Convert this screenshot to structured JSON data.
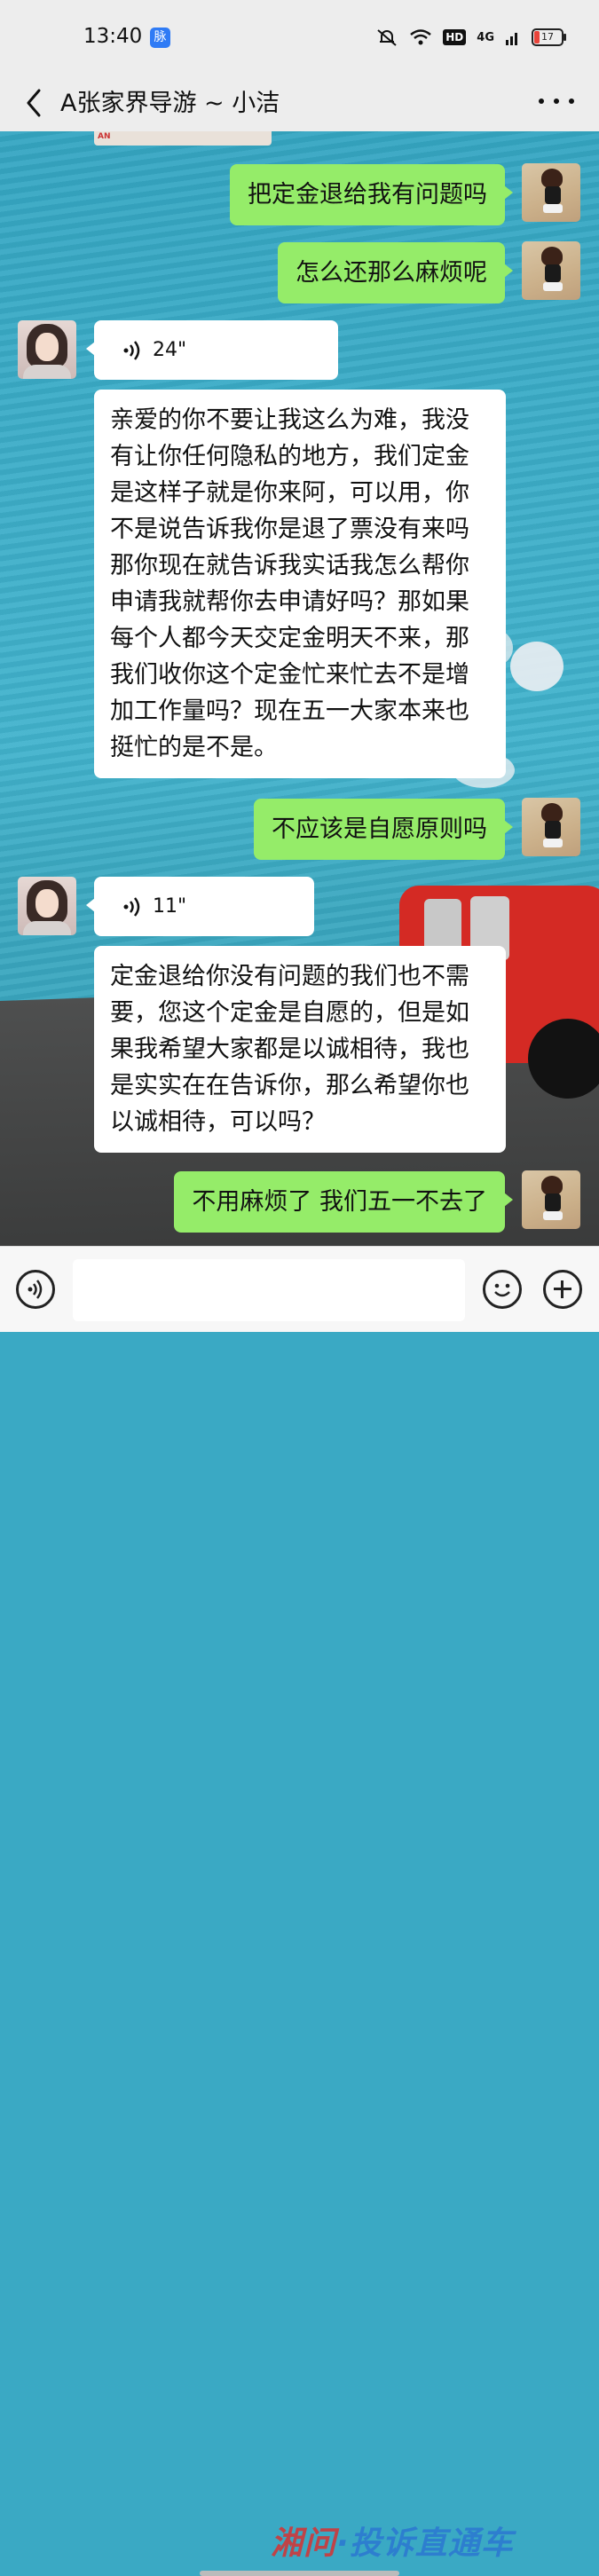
{
  "status_bar": {
    "time": "13:40",
    "app_badge": "脉",
    "hd": "HD",
    "network": "4G",
    "battery": "17"
  },
  "header": {
    "title": "A张家界导游 ~ 小洁"
  },
  "messages": [
    {
      "from": "me",
      "text": "把定金退给我有问题吗"
    },
    {
      "from": "me",
      "text": "怎么还那么麻烦呢"
    },
    {
      "from": "them",
      "type": "voice",
      "duration": "24\""
    },
    {
      "from": "them",
      "lines": [
        "亲爱的你不要让我这么为难，我没",
        "有让你任何隐私的地方，我们定金",
        "是这样子就是你来阿，可以用，你",
        "不是说告诉我你是退了票没有来吗",
        "那你现在就告诉我实话我怎么帮你",
        "申请我就帮你去申请好吗？那如果",
        "每个人都今天交定金明天不来，那",
        "我们收你这个定金忙来忙去不是增",
        "加工作量吗？现在五一大家本来也",
        "挺忙的是不是。"
      ]
    },
    {
      "from": "me",
      "text": "不应该是自愿原则吗"
    },
    {
      "from": "them",
      "type": "voice",
      "duration": "11\""
    },
    {
      "from": "them",
      "lines": [
        "定金退给你没有问题的我们也不需",
        "要，您这个定金是自愿的，但是如",
        "果我希望大家都是以诚相待，我也",
        "是实实在在告诉你，那么希望你也",
        "以诚相待，可以吗？"
      ]
    },
    {
      "from": "me",
      "text": "不用麻烦了 我们五一不去了"
    }
  ],
  "input_bar": {
    "placeholder": ""
  },
  "watermark": {
    "part1": "湘问",
    "part2": "·投诉直通车"
  },
  "icons": [
    "back-arrow-icon",
    "more-dots-icon",
    "voice-wave-icon",
    "voice-input-icon",
    "emoji-icon",
    "plus-icon"
  ],
  "colors": {
    "my_bubble": "#95ec69",
    "their_bubble": "#ffffff",
    "bar": "#ededed"
  }
}
